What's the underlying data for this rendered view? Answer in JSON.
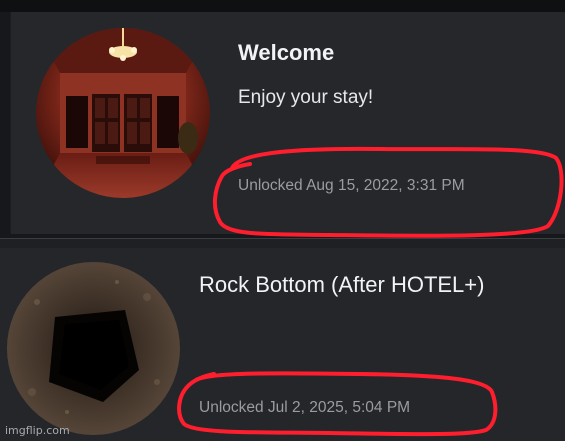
{
  "achievements": [
    {
      "title": "Welcome",
      "description": "Enjoy your stay!",
      "unlocked": "Unlocked Aug 15, 2022, 3:31 PM",
      "image_icon": "hotel-lobby-room-icon"
    },
    {
      "title": "Rock Bottom (After HOTEL+)",
      "unlocked": "Unlocked Jul 2, 2025, 5:04 PM",
      "image_icon": "dark-pit-hole-icon"
    }
  ],
  "annotation_color": "#ff1e2d",
  "watermark": "imgflip.com"
}
